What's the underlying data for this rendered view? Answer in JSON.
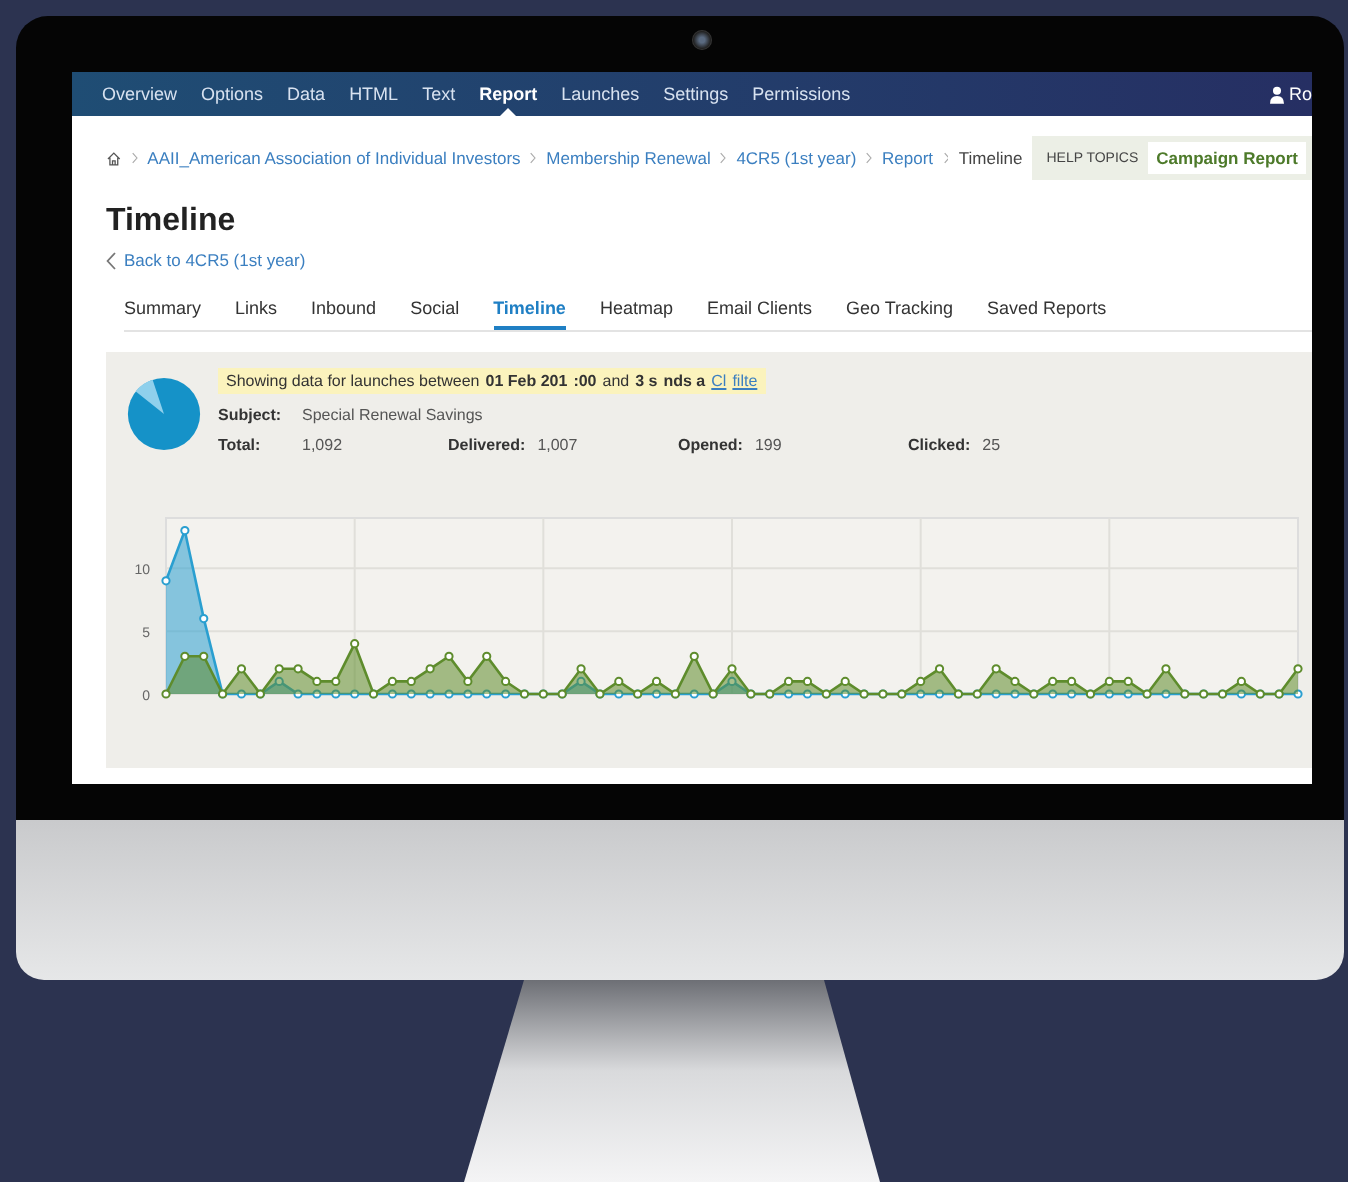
{
  "nav": {
    "items": [
      {
        "label": "Overview",
        "selected": false
      },
      {
        "label": "Options",
        "selected": false
      },
      {
        "label": "Data",
        "selected": false
      },
      {
        "label": "HTML",
        "selected": false
      },
      {
        "label": "Text",
        "selected": false
      },
      {
        "label": "Report",
        "selected": true
      },
      {
        "label": "Launches",
        "selected": false
      },
      {
        "label": "Settings",
        "selected": false
      },
      {
        "label": "Permissions",
        "selected": false
      }
    ],
    "user": "Ro"
  },
  "breadcrumb": [
    {
      "label": "AAII_American Association of Individual Investors",
      "kind": "link"
    },
    {
      "label": "Membership Renewal",
      "kind": "link"
    },
    {
      "label": "4CR5 (1st year)",
      "kind": "link"
    },
    {
      "label": "Report",
      "kind": "link"
    },
    {
      "label": "Timeline",
      "kind": "current"
    }
  ],
  "help": {
    "label": "HELP TOPICS",
    "link": "Campaign Report"
  },
  "page": {
    "title": "Timeline",
    "back": "Back to 4CR5 (1st year)"
  },
  "tabs": [
    {
      "label": "Summary",
      "selected": false
    },
    {
      "label": "Links",
      "selected": false
    },
    {
      "label": "Inbound",
      "selected": false
    },
    {
      "label": "Social",
      "selected": false
    },
    {
      "label": "Timeline",
      "selected": true
    },
    {
      "label": "Heatmap",
      "selected": false
    },
    {
      "label": "Email Clients",
      "selected": false
    },
    {
      "label": "Geo Tracking",
      "selected": false
    },
    {
      "label": "Saved Reports",
      "selected": false
    }
  ],
  "banner": [
    {
      "text": "Showing data for launches between",
      "kind": "plain"
    },
    {
      "text": "01 Feb 201",
      "kind": "bold"
    },
    {
      "text": ":00",
      "kind": "bold"
    },
    {
      "text": "and",
      "kind": "plain"
    },
    {
      "text": "3 s",
      "kind": "bold"
    },
    {
      "text": "nds a",
      "kind": "bold"
    },
    {
      "text": "Cl",
      "kind": "link"
    },
    {
      "text": "filte",
      "kind": "link"
    }
  ],
  "subject": {
    "label": "Subject:",
    "value": "Special Renewal Savings"
  },
  "stats": [
    {
      "label": "Total:",
      "value": "1,092"
    },
    {
      "label": "Delivered:",
      "value": "1,007"
    },
    {
      "label": "Opened:",
      "value": "199"
    },
    {
      "label": "Clicked:",
      "value": "25"
    }
  ],
  "chart_data": {
    "type": "area",
    "grid": true,
    "ylim": [
      0,
      14
    ],
    "yticks": [
      0,
      5,
      10
    ],
    "series": [
      {
        "color": "#2a9fd0",
        "values": [
          9,
          13,
          6,
          0,
          0,
          0,
          1,
          0,
          0,
          0,
          0,
          0,
          0,
          0,
          0,
          0,
          0,
          0,
          0,
          0,
          0,
          0,
          1,
          0,
          0,
          0,
          0,
          0,
          0,
          0,
          1,
          0,
          0,
          0,
          0,
          0,
          0,
          0,
          0,
          0,
          0,
          0,
          0,
          0,
          0,
          0,
          0,
          0,
          0,
          0,
          0,
          0,
          0,
          0,
          0,
          0,
          0,
          0,
          0,
          0,
          0
        ]
      },
      {
        "color": "#5e8c2c",
        "values": [
          0,
          3,
          3,
          0,
          2,
          0,
          2,
          2,
          1,
          1,
          4,
          0,
          1,
          1,
          2,
          3,
          1,
          3,
          1,
          0,
          0,
          0,
          2,
          0,
          1,
          0,
          1,
          0,
          3,
          0,
          2,
          0,
          0,
          1,
          1,
          0,
          1,
          0,
          0,
          0,
          1,
          2,
          0,
          0,
          2,
          1,
          0,
          1,
          1,
          0,
          1,
          1,
          0,
          2,
          0,
          0,
          0,
          1,
          0,
          0,
          2
        ]
      }
    ]
  }
}
